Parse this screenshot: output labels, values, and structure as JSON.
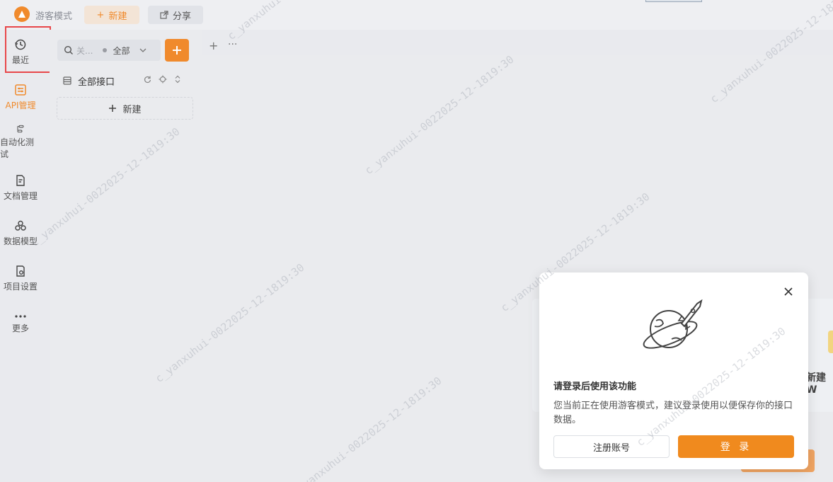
{
  "topbar": {
    "mode_label": "游客模式",
    "new_label": "新建",
    "share_label": "分享"
  },
  "nav": {
    "items": [
      {
        "label": "最近",
        "icon": "history-icon"
      },
      {
        "label": "API管理",
        "icon": "api-icon",
        "active": true
      },
      {
        "label": "自动化测试",
        "icon": "flow-icon"
      },
      {
        "label": "文档管理",
        "icon": "doc-icon"
      },
      {
        "label": "数据模型",
        "icon": "model-icon"
      },
      {
        "label": "项目设置",
        "icon": "settings-icon"
      },
      {
        "label": "更多",
        "icon": "more-icon"
      }
    ]
  },
  "panel": {
    "search_placeholder": "关...",
    "filter_value": "全部",
    "tree_root_label": "全部接口",
    "new_label": "新建"
  },
  "tabs": {
    "add": "+",
    "more": "···"
  },
  "background": {
    "card_text": "新建W"
  },
  "modal": {
    "title": "请登录后使用该功能",
    "body": "您当前正在使用游客模式，建议登录使用以便保存你的接口数据。",
    "register_label": "注册账号",
    "login_label": "登 录"
  },
  "watermark": {
    "text": "c_yanxuhui-0022025-12-1819:30"
  },
  "colors": {
    "accent": "#f08a2c",
    "highlight_border": "#e8474a",
    "login_button": "#f08a1e"
  }
}
